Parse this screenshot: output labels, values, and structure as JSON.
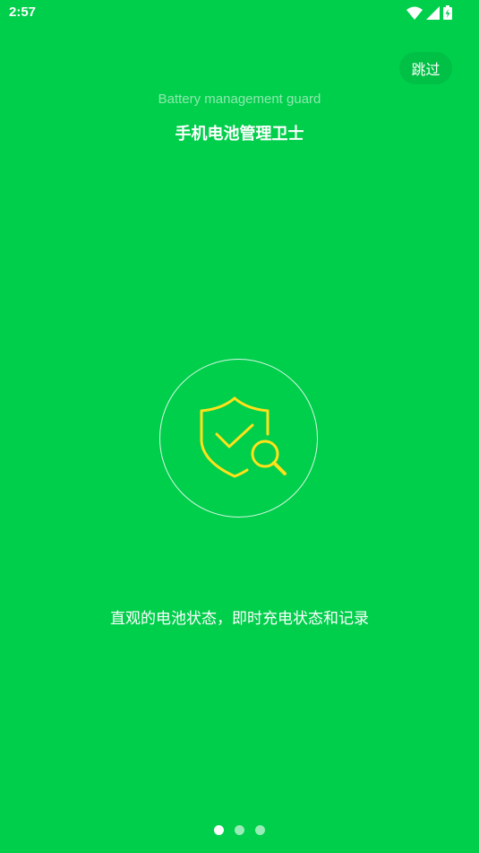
{
  "status_bar": {
    "time": "2:57",
    "icons": [
      "wifi-icon",
      "cellular-signal-icon",
      "battery-charging-icon"
    ]
  },
  "header": {
    "skip_label": "跳过",
    "subtitle": "Battery management guard",
    "title": "手机电池管理卫士"
  },
  "main": {
    "icon": "shield-check-search-icon",
    "description": "直观的电池状态，即时充电状态和记录",
    "accent_color": "#FFE11A",
    "background_color": "#00CF4B"
  },
  "pager": {
    "pages": 3,
    "active_index": 0
  }
}
